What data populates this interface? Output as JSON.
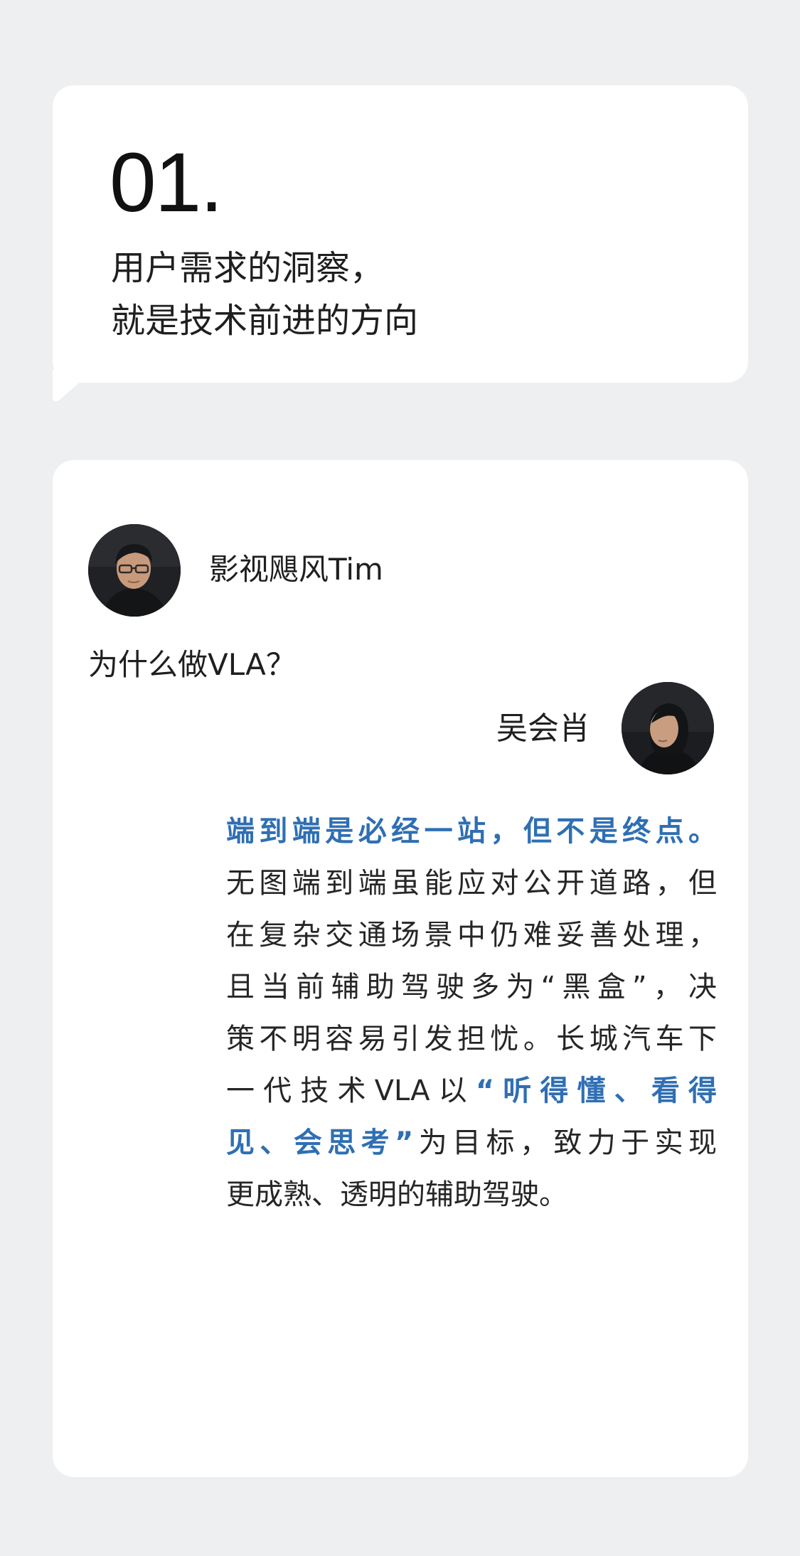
{
  "section": {
    "number": "01.",
    "title_line1": "用户需求的洞察，",
    "title_line2": "就是技术前进的方向"
  },
  "interview": {
    "host": {
      "name": "影视飓风Tim",
      "avatar_icon": "person-avatar"
    },
    "question": "为什么做VLA？",
    "guest": {
      "name": "吴会肖",
      "avatar_icon": "person-avatar"
    },
    "answer": {
      "highlight_color": "#2f6fb3",
      "l1_hl": "端到端是必经一站，但不是终点。",
      "l2": "无图端到端虽能应对公开道路，但",
      "l3": "在复杂交通场景中仍难妥善处理，",
      "l4": "且当前辅助驾驶多为“黑盒”，决",
      "l5": "策不明容易引发担忧。长城汽车下",
      "l6_a": "一代技术VLA以",
      "l6_hl": "“听得懂、看得",
      "l7_hl": "见、会思考”",
      "l7_b": "为目标，致力于实现",
      "l8": "更成熟、透明的辅助驾驶。"
    }
  }
}
